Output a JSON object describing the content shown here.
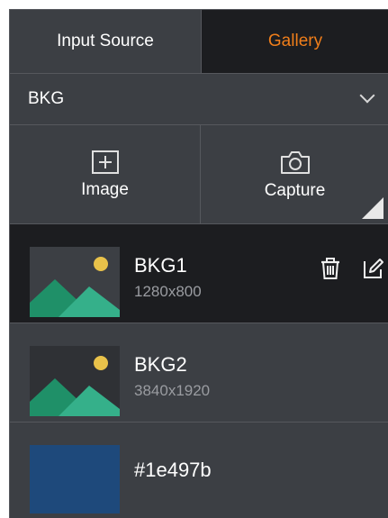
{
  "tabs": {
    "input_source": "Input Source",
    "gallery": "Gallery",
    "active": "gallery"
  },
  "dropdown": {
    "selected": "BKG"
  },
  "actions": {
    "image_label": "Image",
    "capture_label": "Capture"
  },
  "items": [
    {
      "name": "BKG1",
      "resolution": "1280x800",
      "selected": true
    },
    {
      "name": "BKG2",
      "resolution": "3840x1920",
      "selected": false
    }
  ],
  "color_item": {
    "label": "#1e497b",
    "color": "#1e497b"
  },
  "colors": {
    "accent": "#f07e1a",
    "panel_bg": "#2f3135",
    "selected_bg": "#1c1d20"
  }
}
